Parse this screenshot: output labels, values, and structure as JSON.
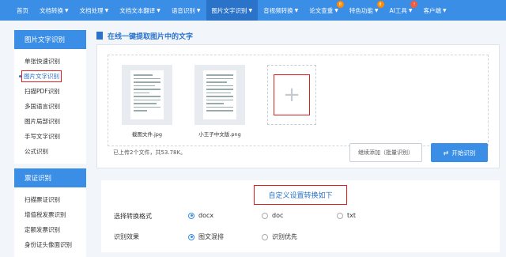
{
  "nav": {
    "items": [
      {
        "label": "首页",
        "caret": false
      },
      {
        "label": "文档转换",
        "caret": true
      },
      {
        "label": "文档处理",
        "caret": true
      },
      {
        "label": "文档文本翻译",
        "caret": true
      },
      {
        "label": "语音识别",
        "caret": true
      },
      {
        "label": "图片文字识别",
        "caret": true,
        "active": true
      },
      {
        "label": "音视频转换",
        "caret": true
      },
      {
        "label": "论文查重",
        "caret": true,
        "badge": "8"
      },
      {
        "label": "特色功能",
        "caret": true,
        "badge": "8"
      },
      {
        "label": "AI工具",
        "caret": true,
        "badge": "!"
      },
      {
        "label": "客户端",
        "caret": true
      }
    ]
  },
  "sidebar": {
    "group1_title": "图片文字识别",
    "group1_items": [
      "单张快速识别",
      "图片文字识别",
      "扫描PDF识别",
      "多国语言识别",
      "图片局部识别",
      "手写文字识别",
      "公式识别"
    ],
    "group2_title": "票证识别",
    "group2_items": [
      "扫描票证识别",
      "增值税发票识别",
      "定额发票识别",
      "身份证头像面识别"
    ]
  },
  "main": {
    "title": "在线一键提取图片中的文字",
    "files": [
      {
        "name": "截图文件.jpg"
      },
      {
        "name": "小王子中文版.png"
      }
    ],
    "upload_count": "已上传2个文件，共53.78K。",
    "add_more": "继续添加（批量识别）",
    "start": "开始识别"
  },
  "settings": {
    "heading": "自定义设置转换如下",
    "format_label": "选择转换格式",
    "formats": [
      "docx",
      "doc",
      "txt"
    ],
    "effect_label": "识别效果",
    "effects": [
      "图文混排",
      "识别优先"
    ]
  }
}
